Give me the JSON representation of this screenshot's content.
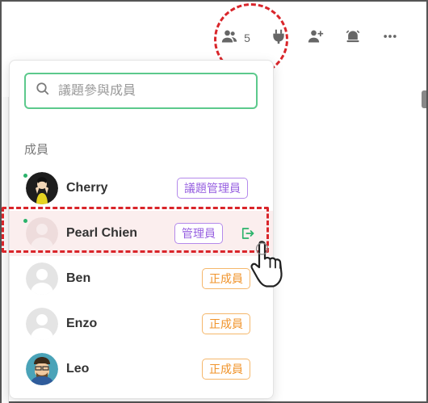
{
  "toolbar": {
    "members_count": "5",
    "icons": [
      "members-icon",
      "plug-icon",
      "add-user-icon",
      "alarm-icon",
      "more-icon"
    ]
  },
  "panel": {
    "search_placeholder": "議題參與成員",
    "section_label": "成員",
    "members": [
      {
        "name": "Cherry",
        "role": "議題管理員",
        "role_color": "#9760e0",
        "online": true
      },
      {
        "name": "Pearl Chien",
        "role": "管理員",
        "role_color": "#9760e0",
        "online": true,
        "selected": true
      },
      {
        "name": "Ben",
        "role": "正成員",
        "role_color": "#f0932a",
        "online": false
      },
      {
        "name": "Enzo",
        "role": "正成員",
        "role_color": "#f0932a",
        "online": false
      },
      {
        "name": "Leo",
        "role": "正成員",
        "role_color": "#f0932a",
        "online": false
      }
    ]
  },
  "colors": {
    "accent_green": "#5cc98c",
    "highlight_red": "#d9252a",
    "leave_green": "#2bb36b"
  }
}
